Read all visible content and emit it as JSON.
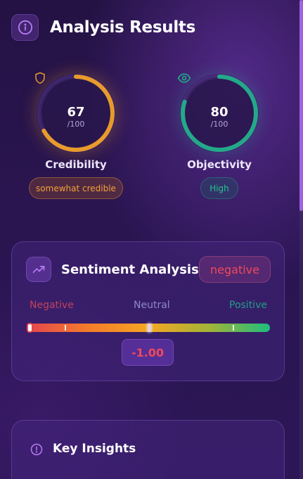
{
  "header": {
    "title": "Analysis Results",
    "icon": "info-icon"
  },
  "metrics": [
    {
      "label": "Credibility",
      "value": "67",
      "max": "/100",
      "score": 67,
      "badge": "somewhat credible",
      "icon": "shield-icon",
      "color": "#e89b2c"
    },
    {
      "label": "Objectivity",
      "value": "80",
      "max": "/100",
      "score": 80,
      "badge": "High",
      "icon": "eye-icon",
      "color": "#23a98a"
    }
  ],
  "sentiment": {
    "title": "Sentiment Analysis",
    "icon": "trending-up-icon",
    "badge": "negative",
    "scale": {
      "negative": "Negative",
      "neutral": "Neutral",
      "positive": "Positive"
    },
    "score_text": "-1.00",
    "score": -1.0,
    "colors": {
      "negative": "#c2415a",
      "neutral": "#8f86c9",
      "positive": "#1f9e86"
    }
  },
  "insights": {
    "title": "Key Insights",
    "icon": "alert-circle-icon"
  }
}
